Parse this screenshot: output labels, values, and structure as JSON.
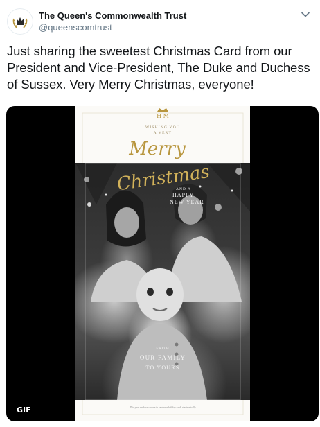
{
  "account": {
    "display_name": "The Queen's Commonwealth Trust",
    "handle": "@queenscomtrust",
    "avatar_icon": "crown-laurel-logo-icon"
  },
  "menu": {
    "caret_icon": "chevron-down-icon"
  },
  "tweet": {
    "text": "Just sharing the sweetest Christmas Card from our President and Vice-President, The Duke and Duchess of Sussex. Very Merry Christmas, everyone!"
  },
  "media": {
    "badge": "GIF",
    "card": {
      "wishing_line1": "WISHING YOU",
      "wishing_line2": "A VERY",
      "script_line1": "Merry",
      "script_line2": "Christmas",
      "and_text": "AND A",
      "happy_text": "HAPPY",
      "new_year_text": "NEW YEAR",
      "from_text": "FROM",
      "our_family_text": "OUR FAMILY",
      "to_yours_text": "TO YOURS",
      "footer_note": "This year we have chosen to celebrate holiday cards electronically"
    }
  },
  "colors": {
    "text_primary": "#14171a",
    "text_secondary": "#657786",
    "card_gold": "#b8963e",
    "media_background": "#000000"
  }
}
